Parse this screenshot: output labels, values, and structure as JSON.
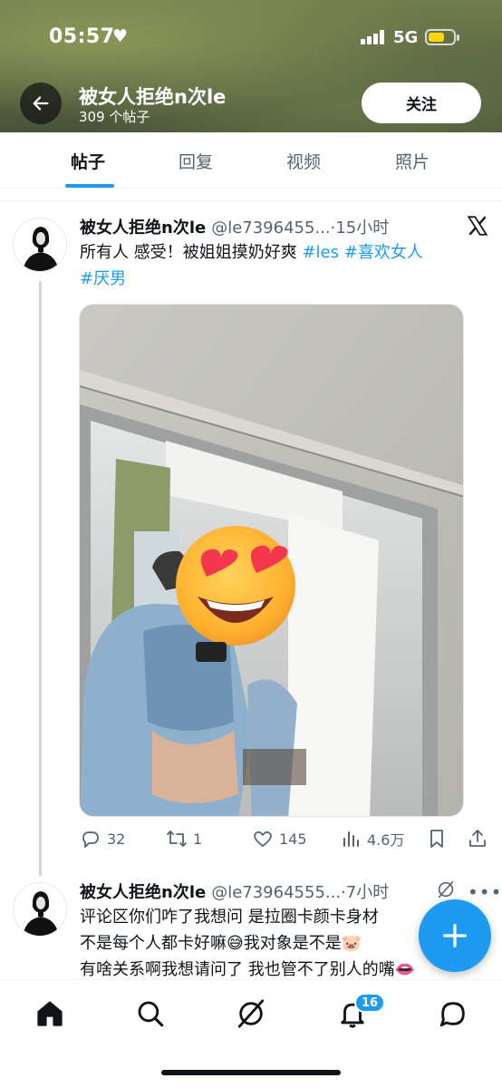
{
  "status_bar": {
    "time": "05:57",
    "network": "5G",
    "battery_level": 0.5
  },
  "header": {
    "profile_name": "被女人拒绝n次le",
    "post_count": "309 个帖子",
    "follow_label": "关注"
  },
  "tabs": [
    {
      "label": "帖子",
      "active": true
    },
    {
      "label": "回复",
      "active": false
    },
    {
      "label": "视频",
      "active": false
    },
    {
      "label": "照片",
      "active": false
    }
  ],
  "post1": {
    "author": "被女人拒绝n次le",
    "handle": "@le7396455...",
    "time": "·15小时",
    "text": "所有人 感受！被姐姐摸奶好爽 ",
    "hashtags": [
      "#les",
      "#喜欢女人",
      "#厌男"
    ],
    "stats": {
      "replies": "32",
      "reposts": "1",
      "likes": "145",
      "views": "4.6万"
    }
  },
  "post2": {
    "author": "被女人拒绝n次le",
    "handle": "@le73964555...",
    "time": "·7小时",
    "line1": "评论区你们咋了我想问 是拉圈卡颜卡身材",
    "line2": "不是每个人都卡好嘛😅我对象是不是🐷",
    "line3": "有啥关系啊我想请问了 我也管不了别人的嘴👄"
  },
  "bottom_nav": {
    "notifications_badge": "16"
  },
  "colors": {
    "accent": "#1d9bf0",
    "text_primary": "#0f1419",
    "text_secondary": "#536471"
  }
}
